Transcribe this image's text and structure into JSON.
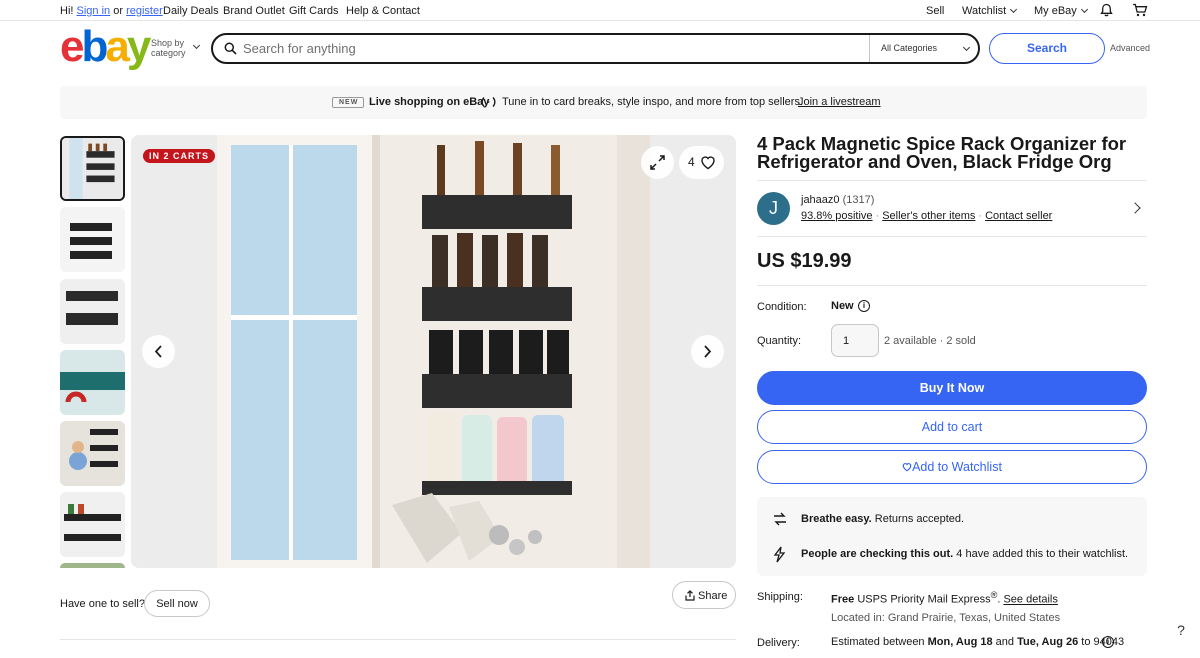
{
  "topbar": {
    "greeting": "Hi!",
    "sign_in": "Sign in",
    "or": "or",
    "register": "register",
    "links": [
      "Daily Deals",
      "Brand Outlet",
      "Gift Cards",
      "Help & Contact"
    ],
    "sell": "Sell",
    "watchlist": "Watchlist",
    "my_ebay": "My eBay",
    "icons": [
      "bell-icon",
      "cart-icon"
    ]
  },
  "header": {
    "logo": [
      "e",
      "b",
      "a",
      "y"
    ],
    "shop_by": "Shop by",
    "category": "category",
    "search_placeholder": "Search for anything",
    "category_select": "All Categories",
    "search_button": "Search",
    "advanced": "Advanced"
  },
  "banner": {
    "badge": "NEW",
    "live": "Live shopping on eBay",
    "tune": "Tune in to card breaks, style inspo, and more from top sellers.",
    "join": "Join a livestream"
  },
  "gallery": {
    "in_carts": "IN 2 CARTS",
    "watch_count": "4",
    "have_one": "Have one to sell?",
    "sell_now": "Sell now",
    "share": "Share"
  },
  "product": {
    "title": "4 Pack Magnetic Spice Rack Organizer for Refrigerator and Oven, Black Fridge Org",
    "seller": {
      "initial": "J",
      "name": "jahaaz0",
      "count": "(1317)",
      "positive": "93.8% positive",
      "other_items": "Seller's other items",
      "contact": "Contact seller"
    },
    "price": "US $19.99",
    "condition_label": "Condition:",
    "condition": "New",
    "quantity_label": "Quantity:",
    "quantity": "1",
    "availability": "2 available · 2 sold",
    "buy_now": "Buy It Now",
    "add_to_cart": "Add to cart",
    "add_to_watchlist": "Add to Watchlist",
    "info": {
      "returns_bold": "Breathe easy.",
      "returns_text": "Returns accepted.",
      "watch_bold": "People are checking this out.",
      "watch_text": "4 have added this to their watchlist."
    },
    "shipping_label": "Shipping:",
    "shipping_free": "Free",
    "shipping_method": "USPS Priority Mail Express",
    "shipping_reg": "®",
    "shipping_period": ".",
    "see_details": "See details",
    "located": "Located in: Grand Prairie, Texas, United States",
    "delivery_label": "Delivery:",
    "delivery_est": "Estimated between",
    "delivery_from": "Mon, Aug 18",
    "delivery_and": "and",
    "delivery_to": "Tue, Aug 26",
    "delivery_zip": "to 94043"
  },
  "help": "?",
  "colors": {
    "accent": "#3665f3",
    "badge_red": "#c4151c",
    "logo_e": "#e53238",
    "logo_b": "#0064d2",
    "logo_a": "#f5af02",
    "logo_y": "#86b817"
  }
}
